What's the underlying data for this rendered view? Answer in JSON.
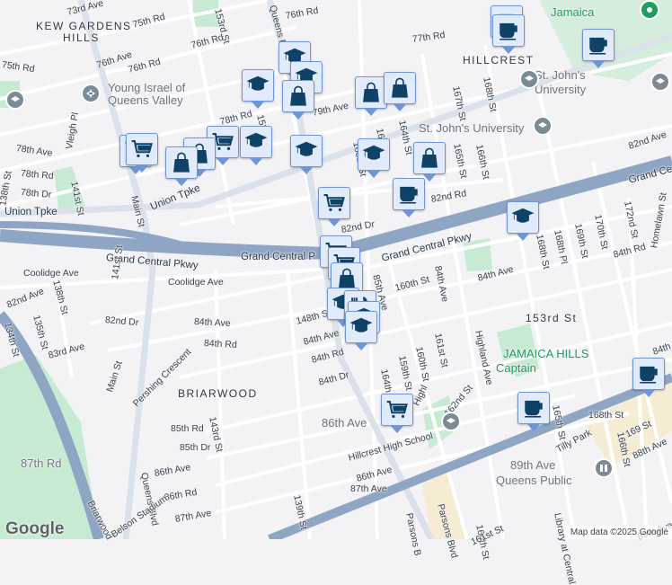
{
  "map": {
    "labels": [
      "73rd Ave",
      "KEW GARDENS",
      "HILLS",
      "75th Rd",
      "153rd St",
      "Queens Blvd",
      "76th Rd",
      "77th Rd",
      "75th Rd",
      "76th Ave",
      "76th Rd",
      "76th Rd",
      "Young Israel of",
      "Queens Valley",
      "HILLCREST",
      "St. John's",
      "University",
      "Union Tpke",
      "79th Ave",
      "78th Rd",
      "153rd St",
      "78th Ave",
      "Vleigh Pl",
      "78th Rd",
      "78th Dr",
      "138th St",
      "141st St",
      "Main St",
      "Union Tpke",
      "Union Tpke",
      "St. John's University",
      "82nd Ave",
      "167th St",
      "168th St",
      "165th St",
      "166th St",
      "164th St",
      "162nd St",
      "160th St",
      "82nd Rd",
      "82nd Dr",
      "Grand Central Pkwy",
      "Grand Central P",
      "Grand Central Pkwy",
      "Grand Ce",
      "168th St",
      "168th Pl",
      "169th St",
      "170th St",
      "172nd St",
      "84th Rd",
      "Homelawn St",
      "84th Ave",
      "Coolidge Ave",
      "Coolidge Ave",
      "82nd Ave",
      "138th St",
      "135th St",
      "134th St",
      "141st St",
      "82nd Dr",
      "83rd Ave",
      "84th Ave",
      "84th Rd",
      "Main St",
      "Pershing Crescent",
      "BRIARWOOD",
      "143rd St",
      "85th Rd",
      "85th Dr",
      "86th Ave",
      "86th Rd",
      "87th Ave",
      "87th Rd",
      "Briarwood",
      "Queens Blvd",
      "139th St",
      "148th St",
      "84th Ave",
      "84th Rd",
      "84th Dr",
      "85th Ave",
      "160th St",
      "84th Ave",
      "164th St",
      "159th St",
      "160th St",
      "161st St",
      "162nd St",
      "86th Ave",
      "Hillcrest High School",
      "86th Ave",
      "87th Ave",
      "Parsons Blvd",
      "Parsons B",
      "153rd St",
      "JAMAICA HILLS",
      "Captain",
      "Tilly Park",
      "Highland Ave",
      "165th St",
      "166th St",
      "168th St",
      "169 St",
      "88th Ave",
      "89th Ave",
      "Queens Public",
      "Library at Central",
      "164th St",
      "161st St",
      "89th Ave",
      "Jamaica",
      "Belson Stadium",
      "84th Dr",
      "Highl",
      "Normal Rd"
    ],
    "markers": [
      "graduation-cap",
      "graduation-cap",
      "shopping-bag",
      "graduation-cap",
      "shopping-cart",
      "shopping-cart",
      "shopping-cart",
      "shopping-bag",
      "shopping-bag",
      "graduation-cap",
      "graduation-cap",
      "shopping-bag",
      "shopping-bag",
      "graduation-cap",
      "shopping-bag",
      "coffee",
      "shopping-cart",
      "coffee",
      "coffee",
      "graduation-cap",
      "shopping-cart",
      "shopping-cart",
      "shopping-bag",
      "graduation-cap",
      "restaurant",
      "graduation-cap",
      "graduation-cap",
      "shopping-cart",
      "coffee",
      "coffee",
      "coffee"
    ],
    "colors": {
      "marker_bg": "#e2ebfb",
      "marker_border": "#6e95d8",
      "marker_icon": "#0e4266",
      "highway": "#8ea5c3",
      "park": "#c7ebd2"
    }
  },
  "branding": {
    "logo": "Google",
    "attribution": "Map data ©2025 Google"
  }
}
